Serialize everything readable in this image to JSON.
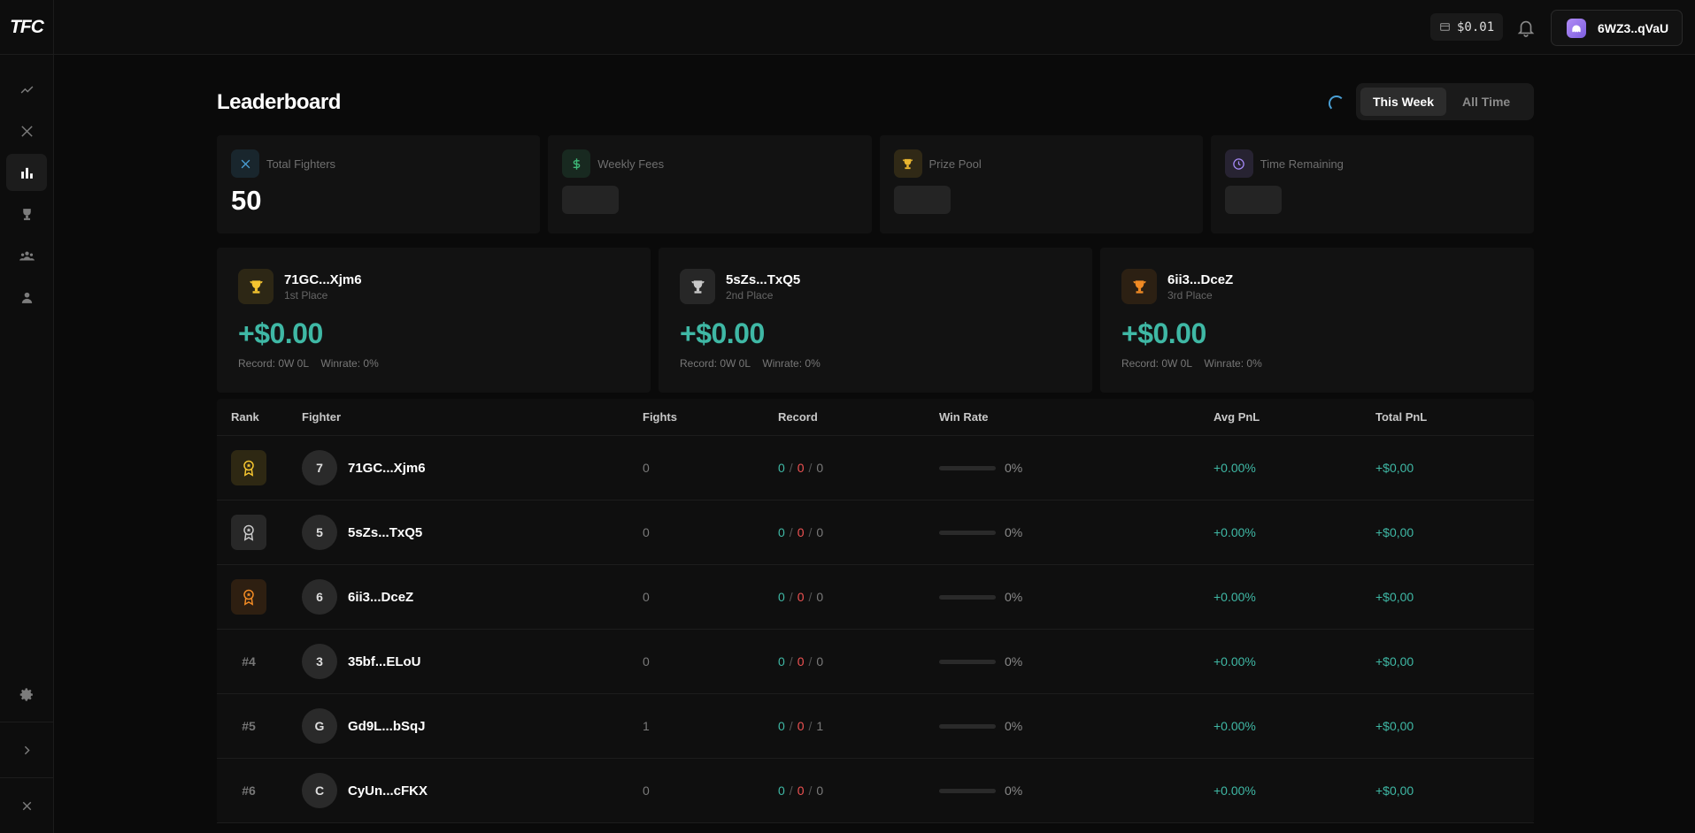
{
  "app": {
    "logo": "TFC"
  },
  "topbar": {
    "balance": "$0.01",
    "wallet": "6WZ3..qVaU"
  },
  "page": {
    "title": "Leaderboard",
    "toggle": [
      "This Week",
      "All Time"
    ],
    "active_toggle": "This Week"
  },
  "stats": [
    {
      "label": "Total Fighters",
      "value": "50",
      "icon": "swords-icon",
      "color": "#4aa0d6"
    },
    {
      "label": "Weekly Fees",
      "value": null,
      "icon": "dollar-icon",
      "color": "#3fb878"
    },
    {
      "label": "Prize Pool",
      "value": null,
      "icon": "trophy-icon",
      "color": "#e8b530"
    },
    {
      "label": "Time Remaining",
      "value": null,
      "icon": "clock-icon",
      "color": "#a78bfa"
    }
  ],
  "podium": [
    {
      "name": "71GC...Xjm6",
      "place": "1st Place",
      "pnl": "+$0.00",
      "record": "Record: 0W 0L",
      "winrate": "Winrate: 0%",
      "color": "#f4c430"
    },
    {
      "name": "5sZs...TxQ5",
      "place": "2nd Place",
      "pnl": "+$0.00",
      "record": "Record: 0W 0L",
      "winrate": "Winrate: 0%",
      "color": "#c8c8c8"
    },
    {
      "name": "6ii3...DceZ",
      "place": "3rd Place",
      "pnl": "+$0.00",
      "record": "Record: 0W 0L",
      "winrate": "Winrate: 0%",
      "color": "#f08a24"
    }
  ],
  "table": {
    "headers": [
      "Rank",
      "Fighter",
      "Fights",
      "Record",
      "Win Rate",
      "Avg PnL",
      "Total PnL"
    ],
    "rows": [
      {
        "rank": "",
        "medal": "gold",
        "initial": "7",
        "name": "71GC...Xjm6",
        "fights": "0",
        "wins": "0",
        "losses": "0",
        "draws": "0",
        "winrate": 0,
        "winrate_label": "0%",
        "avg": "+0.00%",
        "total": "+$0,00"
      },
      {
        "rank": "",
        "medal": "silver",
        "initial": "5",
        "name": "5sZs...TxQ5",
        "fights": "0",
        "wins": "0",
        "losses": "0",
        "draws": "0",
        "winrate": 0,
        "winrate_label": "0%",
        "avg": "+0.00%",
        "total": "+$0,00"
      },
      {
        "rank": "",
        "medal": "bronze",
        "initial": "6",
        "name": "6ii3...DceZ",
        "fights": "0",
        "wins": "0",
        "losses": "0",
        "draws": "0",
        "winrate": 0,
        "winrate_label": "0%",
        "avg": "+0.00%",
        "total": "+$0,00"
      },
      {
        "rank": "#4",
        "medal": "",
        "initial": "3",
        "name": "35bf...ELoU",
        "fights": "0",
        "wins": "0",
        "losses": "0",
        "draws": "0",
        "winrate": 0,
        "winrate_label": "0%",
        "avg": "+0.00%",
        "total": "+$0,00"
      },
      {
        "rank": "#5",
        "medal": "",
        "initial": "G",
        "name": "Gd9L...bSqJ",
        "fights": "1",
        "wins": "0",
        "losses": "0",
        "draws": "1",
        "winrate": 0,
        "winrate_label": "0%",
        "avg": "+0.00%",
        "total": "+$0,00"
      },
      {
        "rank": "#6",
        "medal": "",
        "initial": "C",
        "name": "CyUn...cFKX",
        "fights": "0",
        "wins": "0",
        "losses": "0",
        "draws": "0",
        "winrate": 0,
        "winrate_label": "0%",
        "avg": "+0.00%",
        "total": "+$0,00"
      }
    ]
  },
  "medal_colors": {
    "gold": "#f4c430",
    "silver": "#c8c8c8",
    "bronze": "#f08a24"
  }
}
